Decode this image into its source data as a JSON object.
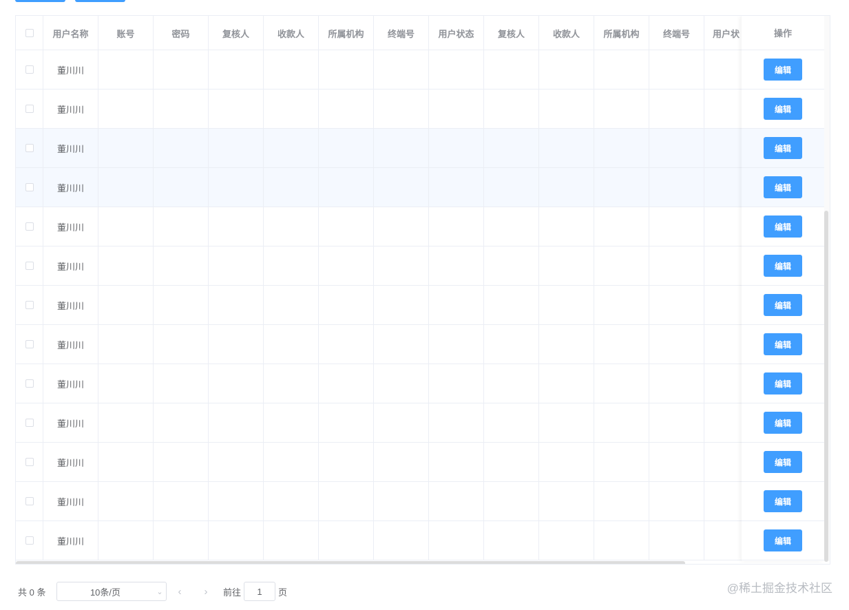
{
  "table": {
    "columns": [
      "用户名称",
      "账号",
      "密码",
      "复核人",
      "收款人",
      "所属机构",
      "终端号",
      "用户状态",
      "复核人",
      "收款人",
      "所属机构",
      "终端号",
      "用户状"
    ],
    "action_header": "操作",
    "rows": [
      {
        "name": "董川川",
        "action": "编辑"
      },
      {
        "name": "董川川",
        "action": "编辑"
      },
      {
        "name": "董川川",
        "action": "编辑"
      },
      {
        "name": "董川川",
        "action": "编辑"
      },
      {
        "name": "董川川",
        "action": "编辑"
      },
      {
        "name": "董川川",
        "action": "编辑"
      },
      {
        "name": "董川川",
        "action": "编辑"
      },
      {
        "name": "董川川",
        "action": "编辑"
      },
      {
        "name": "董川川",
        "action": "编辑"
      },
      {
        "name": "董川川",
        "action": "编辑"
      },
      {
        "name": "董川川",
        "action": "编辑"
      },
      {
        "name": "董川川",
        "action": "编辑"
      },
      {
        "name": "董川川",
        "action": "编辑"
      }
    ]
  },
  "pagination": {
    "total": "共 0 条",
    "page_size": "10条/页",
    "goto_prefix": "前往",
    "current_page": "1",
    "goto_suffix": "页"
  },
  "watermark": "@稀土掘金技术社区",
  "colors": {
    "primary": "#409eff",
    "border": "#ebeef5",
    "header_text": "#909399",
    "row_highlight": "#f5f9ff"
  }
}
